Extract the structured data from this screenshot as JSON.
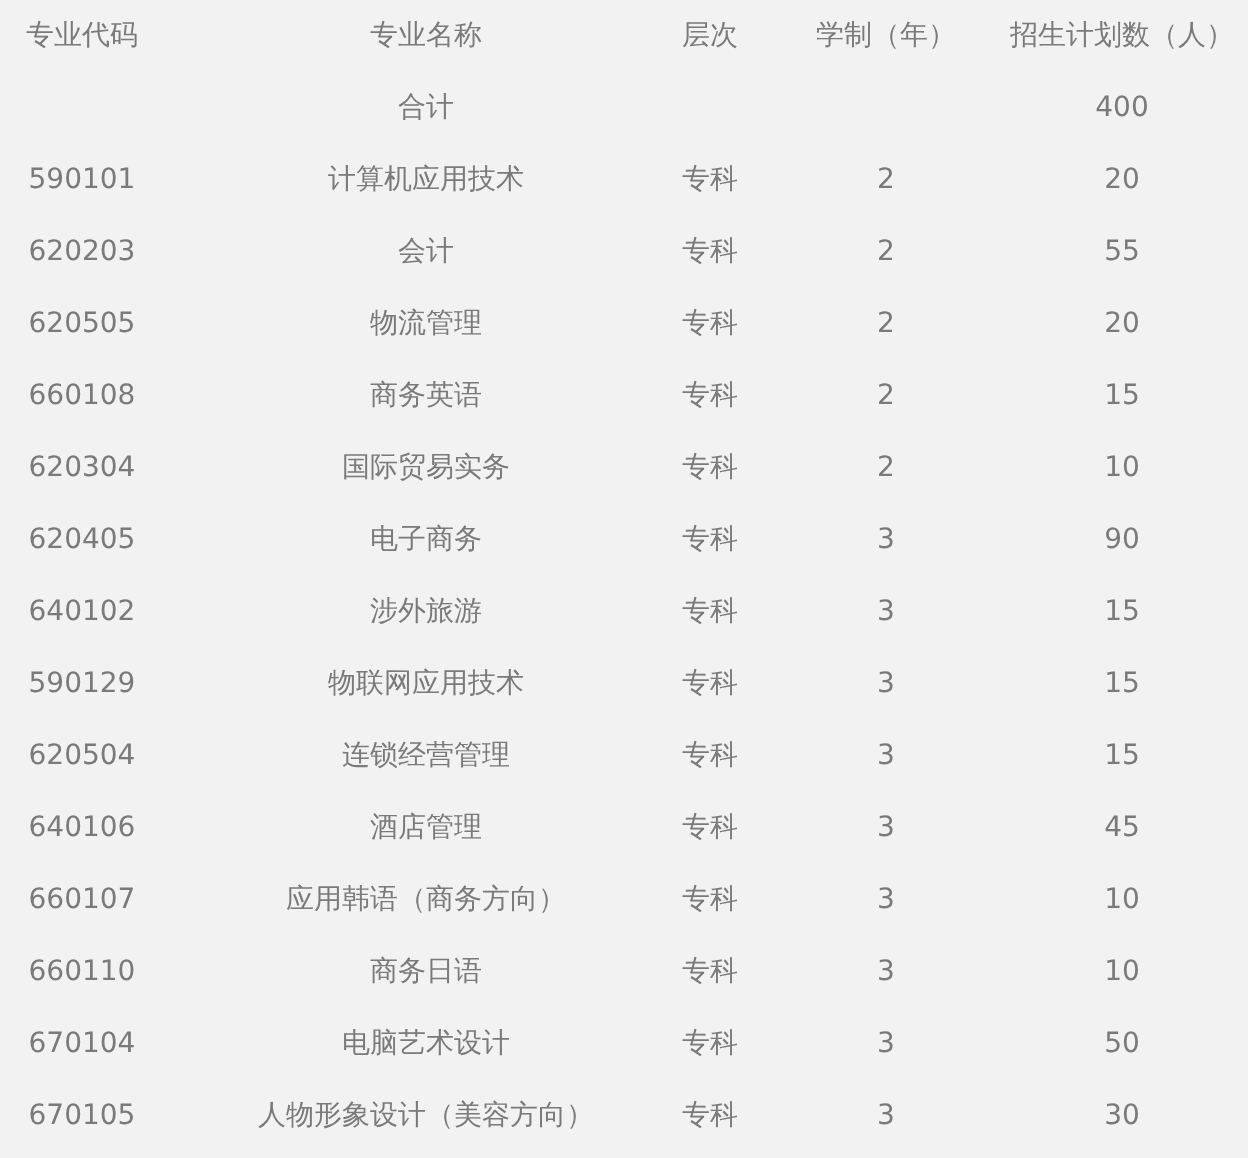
{
  "table": {
    "columns": [
      "专业代码",
      "专业名称",
      "层次",
      "学制（年）",
      "招生计划数（人）"
    ],
    "total": {
      "label": "合计",
      "value": "400"
    },
    "rows": [
      {
        "code": "590101",
        "name": "计算机应用技术",
        "level": "专科",
        "years": "2",
        "plan": "20"
      },
      {
        "code": "620203",
        "name": "会计",
        "level": "专科",
        "years": "2",
        "plan": "55"
      },
      {
        "code": "620505",
        "name": "物流管理",
        "level": "专科",
        "years": "2",
        "plan": "20"
      },
      {
        "code": "660108",
        "name": "商务英语",
        "level": "专科",
        "years": "2",
        "plan": "15"
      },
      {
        "code": "620304",
        "name": "国际贸易实务",
        "level": "专科",
        "years": "2",
        "plan": "10"
      },
      {
        "code": "620405",
        "name": "电子商务",
        "level": "专科",
        "years": "3",
        "plan": "90"
      },
      {
        "code": "640102",
        "name": "涉外旅游",
        "level": "专科",
        "years": "3",
        "plan": "15"
      },
      {
        "code": "590129",
        "name": "物联网应用技术",
        "level": "专科",
        "years": "3",
        "plan": "15"
      },
      {
        "code": "620504",
        "name": "连锁经营管理",
        "level": "专科",
        "years": "3",
        "plan": "15"
      },
      {
        "code": "640106",
        "name": "酒店管理",
        "level": "专科",
        "years": "3",
        "plan": "45"
      },
      {
        "code": "660107",
        "name": "应用韩语（商务方向）",
        "level": "专科",
        "years": "3",
        "plan": "10"
      },
      {
        "code": "660110",
        "name": "商务日语",
        "level": "专科",
        "years": "3",
        "plan": "10"
      },
      {
        "code": "670104",
        "name": "电脑艺术设计",
        "level": "专科",
        "years": "3",
        "plan": "50"
      },
      {
        "code": "670105",
        "name": "人物形象设计（美容方向）",
        "level": "专科",
        "years": "3",
        "plan": "30"
      }
    ]
  }
}
